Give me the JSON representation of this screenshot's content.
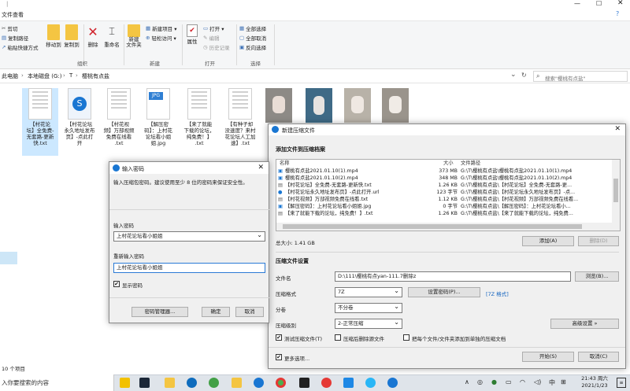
{
  "explorer": {
    "tabs": [
      "文件",
      "主页",
      "共享",
      "查看"
    ],
    "ribbon": {
      "clipboard": {
        "cut": "剪切",
        "copy_path": "复制路径",
        "paste_shortcut": "粘贴快捷方式",
        "move_to": "移动到",
        "copy_to": "复制到"
      },
      "organize": {
        "delete": "删除",
        "rename": "重命名",
        "group": "组织"
      },
      "new": {
        "new_item": "新建项目 ▾",
        "easy_access": "轻松访问 ▾",
        "new_folder": "新建\n文件夹",
        "group": "新建"
      },
      "open": {
        "properties": "属性",
        "open": "打开 ▾",
        "edit": "编辑",
        "history": "历史记录",
        "group": "打开"
      },
      "select": {
        "select_all": "全部选择",
        "select_none": "全部取消",
        "invert": "反向选择",
        "group": "选择"
      }
    },
    "address": {
      "crumbs": [
        "此电脑",
        "本地磁盘 (G:)",
        "T",
        "樱桃有点盐"
      ],
      "search_placeholder": "搜索\"樱桃有点盐\""
    },
    "files": [
      {
        "name": "【村花论坛】全免费-无套路-更新快.txt",
        "lines": [
          "【村花论",
          "坛】全免费-",
          "无套路-更新",
          "快.txt"
        ]
      },
      {
        "name": "【村花论坛永久地址发布页】-点此打开",
        "lines": [
          "【村花论坛",
          "永久地址发布",
          "页】-点此打",
          "开"
        ]
      },
      {
        "name": "【村花视频】万部视频免费在线看.txt",
        "lines": [
          "【村花视",
          "频】万部视频",
          "免费在线看",
          ".txt"
        ]
      },
      {
        "name": "【解压密码】：上村花论坛看小姐姐.jpg",
        "lines": [
          "【解压密",
          "码】：上村花",
          "论坛看小姐",
          "姐.jpg"
        ]
      },
      {
        "name": "【来了就能下载的论坛，纯免费！】.txt",
        "lines": [
          "【来了就能",
          "下载的论坛，",
          "纯免费！】",
          ".txt"
        ]
      },
      {
        "name": "【有种子却没速度？来村花论坛人工加速】.txt",
        "lines": [
          "【有种子却",
          "没速度？来村",
          "花论坛人工加",
          "速】.txt"
        ]
      }
    ],
    "status": "10 个项目"
  },
  "zip_dialog": {
    "title": "新建压缩文件",
    "section_add": "添加文件到压缩档案",
    "columns": {
      "name": "名称",
      "size": "大小",
      "path": "文件路径"
    },
    "rows": [
      {
        "name": "樱桃有点盐2021.01.10(1).mp4",
        "size": "373 MB",
        "path": "G:\\T\\樱桃有点盐\\樱桃有点盐2021.01.10(1).mp4"
      },
      {
        "name": "樱桃有点盐2021.01.10(2).mp4",
        "size": "348 MB",
        "path": "G:\\T\\樱桃有点盐\\樱桃有点盐2021.01.10(2).mp4"
      },
      {
        "name": "【村花论坛】全免费-无套路-更新快.txt",
        "size": "1.26 KB",
        "path": "G:\\T\\樱桃有点盐\\【村花论坛】全免费-无套路-更..."
      },
      {
        "name": "【村花论坛永久地址发布页】-点此打开.url",
        "size": "123 字节",
        "path": "G:\\T\\樱桃有点盐\\【村花论坛永久地址发布页】-点..."
      },
      {
        "name": "【村花视频】万部视频免费在线看.txt",
        "size": "1.12 KB",
        "path": "G:\\T\\樱桃有点盐\\【村花视频】万部视频免费在线看..."
      },
      {
        "name": "【解压密码】：上村花论坛看小姐姐.jpg",
        "size": "0 字节",
        "path": "G:\\T\\樱桃有点盐\\【解压密码】：上村花论坛看小..."
      },
      {
        "name": "【来了就能下载的论坛，纯免费！】.txt",
        "size": "1.26 KB",
        "path": "G:\\T\\樱桃有点盐\\【来了就能下载的论坛，纯免费..."
      }
    ],
    "total": "总大小: 1.41 GB",
    "add_btn": "添加(A)",
    "delete_btn": "删除(D)",
    "section_settings": "压缩文件设置",
    "filename_label": "文件名",
    "filename_value": "D:\\111\\樱桃有点yan-111.7删除z",
    "browse_btn": "浏览(B)...",
    "format_label": "压缩格式",
    "format_value": "7Z",
    "set_password_btn": "设置密码(P)...",
    "format_note": "[7Z 格式]",
    "split_label": "分卷",
    "split_value": "不分卷",
    "level_label": "压缩级别",
    "level_value": "2-正常压缩",
    "advanced_btn": "高级设置 »",
    "test_chk": "测试压缩文件(T)",
    "delete_after_chk": "压缩后删除源文件",
    "each_file_chk": "把每个文件/文件夹添加到单独的压缩文档",
    "more_options": "更多选项...",
    "start_btn": "开始(S)",
    "cancel_btn": "取消(C)"
  },
  "password_dialog": {
    "title": "输入密码",
    "hint": "输入压缩包密码。建议使用至少 8 位的密码来保证安全性。",
    "enter_label": "输入密码",
    "enter_value": "上村花论坛看小姐姐",
    "reenter_label": "重新输入密码",
    "reenter_value": "上村花论坛看小姐姐",
    "show_password": "显示密码",
    "manager_btn": "密码管理器...",
    "ok_btn": "确定",
    "cancel_btn": "取消"
  },
  "taskbar": {
    "search_placeholder": "入你要搜索的内容",
    "ime": "中",
    "time": "21:43 周六",
    "date": "2021/1/23"
  }
}
